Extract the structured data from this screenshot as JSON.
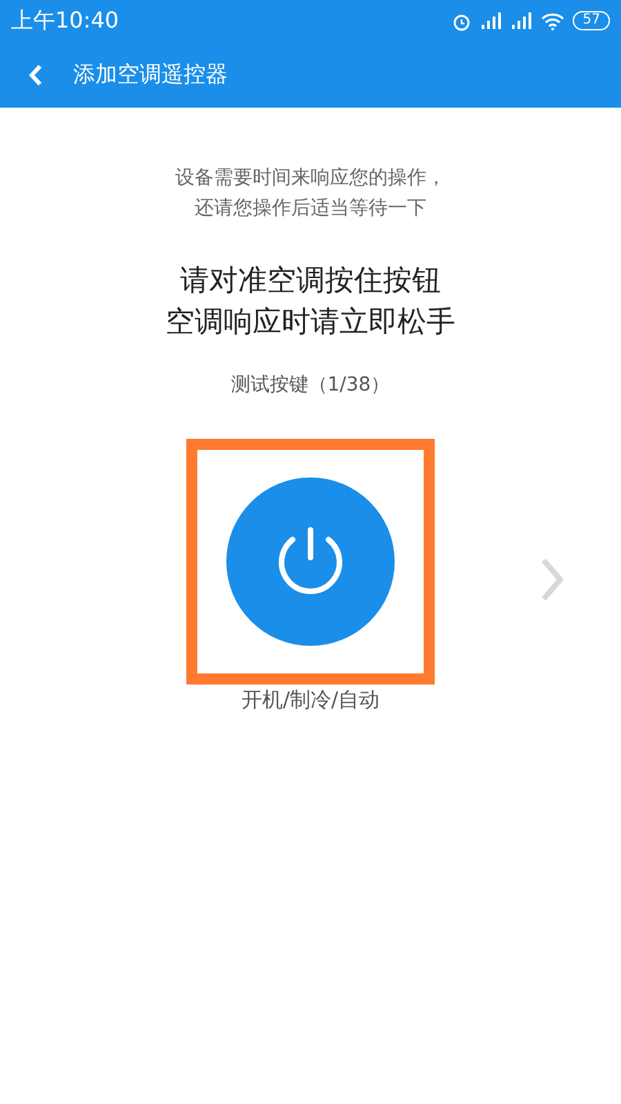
{
  "status_bar": {
    "time": "上午10:40",
    "battery": "57"
  },
  "header": {
    "title": "添加空调遥控器"
  },
  "hint": [
    "设备需要时间来响应您的操作，",
    "还请您操作后适当等待一下"
  ],
  "instruction": [
    "请对准空调按住按钮",
    "空调响应时请立即松手"
  ],
  "progress": "测试按键（1/38）",
  "test_key": {
    "label": "开机/制冷/自动",
    "highlighted": true
  }
}
